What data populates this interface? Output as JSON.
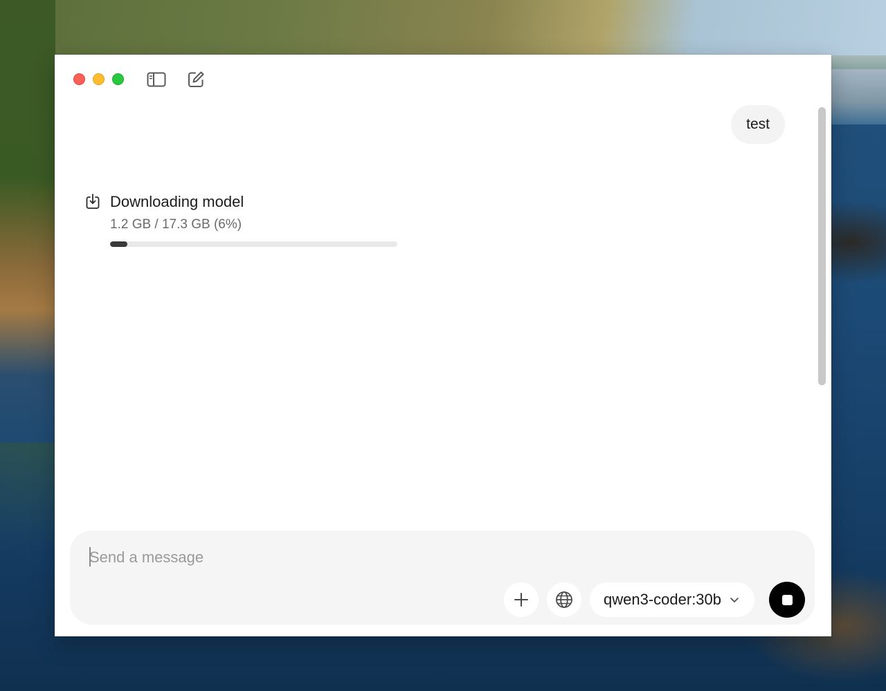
{
  "window": {
    "controls": [
      "close",
      "minimize",
      "zoom"
    ],
    "toolbar": {
      "sidebar_icon": "sidebar-toggle-icon",
      "compose_icon": "new-chat-icon"
    }
  },
  "conversation": {
    "user_message": "test",
    "download": {
      "icon": "download-icon",
      "title": "Downloading model",
      "progress_text": "1.2 GB / 17.3 GB (6%)",
      "progress_percent": 6
    }
  },
  "composer": {
    "placeholder": "Send a message",
    "value": "",
    "attach_icon": "plus-icon",
    "web_search_icon": "globe-icon",
    "model": "qwen3-coder:30b",
    "model_dropdown_icon": "chevron-down-icon",
    "stop_icon": "stop-icon"
  },
  "colors": {
    "close": "#fe5f57",
    "minimize": "#febc2e",
    "zoom": "#28c840",
    "progress_fill": "#3a3a3a",
    "progress_track": "#e9e9e9",
    "composer_bg": "#f5f5f5",
    "stop_button": "#000000"
  }
}
